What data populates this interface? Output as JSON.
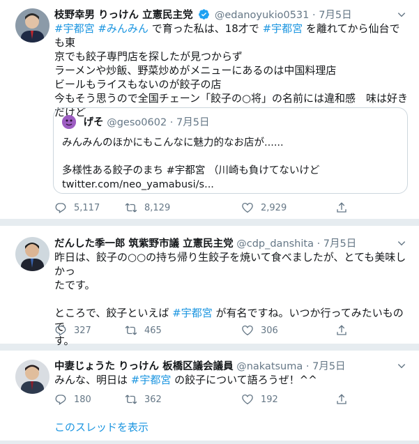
{
  "tweets": [
    {
      "name": "枝野幸男 りっけん 立憲民主党",
      "handle": "@edanoyukio0531",
      "date": "· 7月5日",
      "lines": [
        [
          {
            "t": "#宇都宮",
            "tag": true
          },
          {
            "t": " ",
            "tag": false
          },
          {
            "t": "#みんみん",
            "tag": true
          },
          {
            "t": " で育った私は、18才で ",
            "tag": false
          },
          {
            "t": "#宇都宮",
            "tag": true
          },
          {
            "t": " を離れてから仙台でも東",
            "tag": false
          }
        ],
        [
          {
            "t": "京でも餃子専門店を探したが見つからず",
            "tag": false
          }
        ],
        [
          {
            "t": "ラーメンや炒飯、野菜炒めがメニューにあるのは中国料理店",
            "tag": false
          }
        ],
        [
          {
            "t": "ビールもライスもないのが餃子の店",
            "tag": false
          }
        ],
        [
          {
            "t": "今もそう思うので全国チェーン「餃子の○将」の名前には違和感　味は好き",
            "tag": false
          }
        ],
        [
          {
            "t": "だけど",
            "tag": false
          }
        ]
      ],
      "quote": {
        "name": "げそ",
        "handle": "@geso0602",
        "date": "· 7月5日",
        "lines": [
          "みんみんのほかにもこんなに魅力的なお店が......",
          "",
          "多様性ある餃子のまち #宇都宮 （川崎も負けてないけど",
          "twitter.com/neo_yamabusi/s..."
        ]
      },
      "replies": "5,117",
      "retweets": "8,129",
      "likes": "2,929"
    },
    {
      "name": "だんした季一郎 筑紫野市議 立憲民主党",
      "handle": "@cdp_danshita",
      "date": "· 7月5日",
      "lines": [
        [
          {
            "t": "昨日は、餃子の○○の持ち帰り生餃子を焼いて食べましたが、とても美味しかっ",
            "tag": false
          }
        ],
        [
          {
            "t": "たです。",
            "tag": false
          }
        ],
        [
          {
            "t": "",
            "tag": false
          }
        ],
        [
          {
            "t": "ところで、餃子といえば ",
            "tag": false
          },
          {
            "t": "#宇都宮",
            "tag": true
          },
          {
            "t": " が有名ですね。いつか行ってみたいもので",
            "tag": false
          }
        ],
        [
          {
            "t": "す。",
            "tag": false
          }
        ]
      ],
      "replies": "327",
      "retweets": "465",
      "likes": "306"
    },
    {
      "name": "中妻じょうた りっけん 板橋区議会議員",
      "handle": "@nakatsuma",
      "date": "· 7月5日",
      "lines": [
        [
          {
            "t": "みんな、明日は ",
            "tag": false
          },
          {
            "t": "#宇都宮",
            "tag": true
          },
          {
            "t": " の餃子について語ろうぜ！^^",
            "tag": false
          }
        ]
      ],
      "replies": "180",
      "retweets": "362",
      "likes": "192",
      "show_thread": "このスレッドを表示"
    }
  ],
  "colors": {
    "link": "#1b95e0",
    "muted": "#657786",
    "verified": "#1da1f2",
    "divider": "#e6ecf0"
  },
  "icons": [
    "reply-icon",
    "retweet-icon",
    "like-icon",
    "share-icon",
    "verified-badge-icon",
    "chevron-down-icon"
  ]
}
